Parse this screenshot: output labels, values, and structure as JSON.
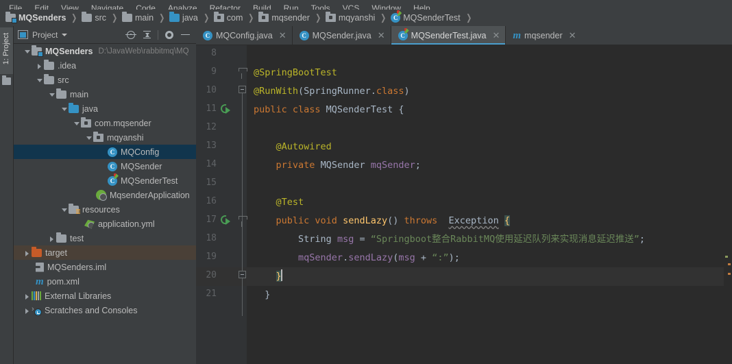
{
  "menu": {
    "items": [
      "File",
      "Edit",
      "View",
      "Navigate",
      "Code",
      "Analyze",
      "Refactor",
      "Build",
      "Run",
      "Tools",
      "VCS",
      "Window",
      "Help"
    ]
  },
  "breadcrumb": [
    {
      "label": "MQSenders"
    },
    {
      "label": "src"
    },
    {
      "label": "main"
    },
    {
      "label": "java"
    },
    {
      "label": "com"
    },
    {
      "label": "mqsender"
    },
    {
      "label": "mqyanshi"
    },
    {
      "label": "MQSenderTest"
    }
  ],
  "tool_strip": {
    "project_label": "1: Project"
  },
  "panel": {
    "title": "Project"
  },
  "tree": [
    {
      "label": "MQSenders",
      "path": "D:\\JavaWeb\\rabbitmq\\MQ"
    },
    {
      "label": ".idea"
    },
    {
      "label": "src"
    },
    {
      "label": "main"
    },
    {
      "label": "java"
    },
    {
      "label": "com.mqsender"
    },
    {
      "label": "mqyanshi"
    },
    {
      "label": "MQConfig"
    },
    {
      "label": "MQSender"
    },
    {
      "label": "MQSenderTest"
    },
    {
      "label": "MqsenderApplication"
    },
    {
      "label": "resources"
    },
    {
      "label": "application.yml"
    },
    {
      "label": "test"
    },
    {
      "label": "target"
    },
    {
      "label": "MQSenders.iml"
    },
    {
      "label": "pom.xml"
    },
    {
      "label": "External Libraries"
    },
    {
      "label": "Scratches and Consoles"
    }
  ],
  "tabs": [
    {
      "label": "MQConfig.java",
      "active": false
    },
    {
      "label": "MQSender.java",
      "active": false
    },
    {
      "label": "MQSenderTest.java",
      "active": true
    },
    {
      "label": "mqsender",
      "active": false
    }
  ],
  "code": {
    "file": "MQSenderTest.java",
    "string_literal": "“Springboot整合RabbitMQ使用延迟队列来实现消息延迟推送”",
    "string_literal2": "“:”",
    "lines": [
      {
        "num": "8",
        "text": ""
      },
      {
        "num": "9",
        "text": "@SpringBootTest"
      },
      {
        "num": "10",
        "text": "@RunWith(SpringRunner.class)"
      },
      {
        "num": "11",
        "text": "public class MQSenderTest {"
      },
      {
        "num": "12",
        "text": ""
      },
      {
        "num": "13",
        "text": "    @Autowired"
      },
      {
        "num": "14",
        "text": "    private MQSender mqSender;"
      },
      {
        "num": "15",
        "text": ""
      },
      {
        "num": "16",
        "text": "    @Test"
      },
      {
        "num": "17",
        "text": "    public void sendLazy() throws  Exception {"
      },
      {
        "num": "18",
        "text": "        String msg = “Springboot整合RabbitMQ使用延迟队列来实现消息延迟推送”;"
      },
      {
        "num": "19",
        "text": "        mqSender.sendLazy(msg + “:”);"
      },
      {
        "num": "20",
        "text": "    }"
      },
      {
        "num": "21",
        "text": "  }"
      }
    ]
  },
  "colors": {
    "panel_background": "#3c3f41",
    "editor_background": "#2b2b2b",
    "gutter_background": "#313335",
    "selection_blue": "#11354d",
    "excluded_tint": "#4a4037",
    "tab_active": "#4e5254",
    "tab_underline": "#4a9ece",
    "keyword_orange": "#cc7832",
    "annotation_yellow": "#bbb529",
    "string_green": "#6a8759",
    "method_gold": "#ffc66d",
    "field_purple": "#9876aa",
    "text_default": "#a9b7c6",
    "run_icon_green": "#499c54",
    "brace_match": "#3b514d"
  }
}
